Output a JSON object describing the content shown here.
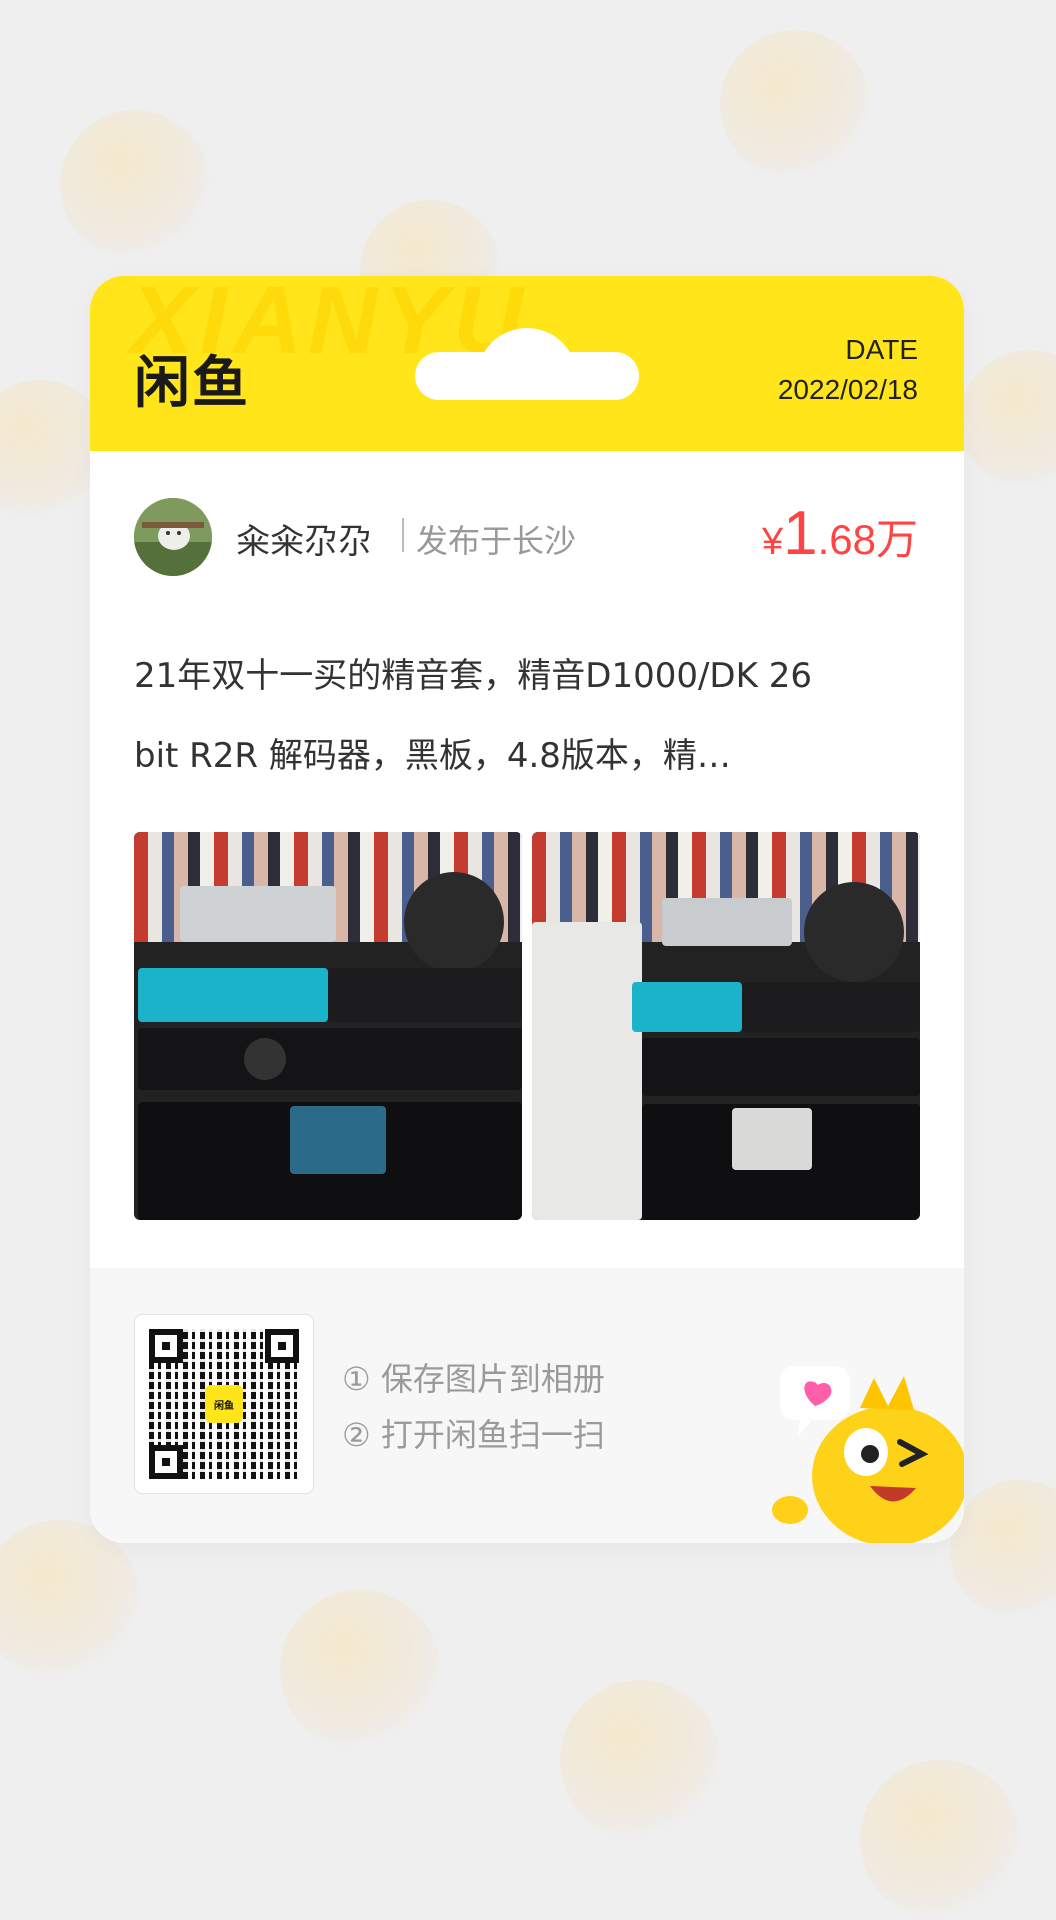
{
  "header": {
    "watermark": "XIANYU",
    "logo": "闲鱼",
    "date_label": "DATE",
    "date_value": "2022/02/18"
  },
  "seller": {
    "name": "籴籴尕尕",
    "location": "发布于长沙"
  },
  "price": {
    "symbol": "¥",
    "integer": "1",
    "rest": ".68万"
  },
  "description": {
    "line1": "21年双十一买的精音套，精音D1000/DK 26",
    "line2": "bit R2R 解码器，黑板，4.8版本，精…"
  },
  "photos": [
    {
      "alt": "audio equipment stack 1"
    },
    {
      "alt": "audio equipment stack 2"
    }
  ],
  "footer": {
    "qr_center_label": "闲鱼",
    "step1": "① 保存图片到相册",
    "step2": "② 打开闲鱼扫一扫"
  },
  "colors": {
    "brand_yellow": "#ffe51a",
    "price_red": "#ff4444"
  }
}
